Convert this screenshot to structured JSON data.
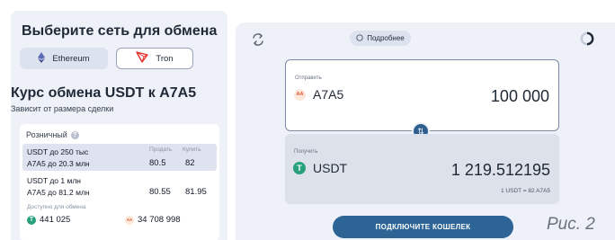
{
  "network": {
    "title": "Выберите сеть для обмена",
    "options": [
      {
        "label": "Ethereum",
        "icon": "ethereum-icon",
        "selected": false
      },
      {
        "label": "Tron",
        "icon": "tron-icon",
        "selected": true
      }
    ]
  },
  "rate": {
    "title": "Курс обмена USDT к A7A5",
    "subtitle": "Зависит от размера сделки",
    "card_title": "Розничный",
    "sell_header": "Продать",
    "buy_header": "Купить",
    "tiers": [
      {
        "line1": "USDT до 250 тыс",
        "line2": "A7A5 до 20.3 млн",
        "sell": "80.5",
        "buy": "82",
        "highlighted": true
      },
      {
        "line1": "USDT до 1 млн",
        "line2": "A7A5 до 81.2 млн",
        "sell": "80.55",
        "buy": "81.95",
        "highlighted": false
      }
    ],
    "available_label": "Доступно для обмена",
    "available_usdt": "441 025",
    "available_a7a5": "34 708 998"
  },
  "exchange": {
    "more_label": "Подробнее",
    "send_label": "Отправить",
    "send_coin": "A7A5",
    "send_coin_icon_text": "AA",
    "send_amount": "100 000",
    "receive_label": "Получить",
    "receive_coin": "USDT",
    "receive_coin_icon_text": "T",
    "receive_amount": "1 219.512195",
    "rate_note": "1 USDT = 82 A7A5",
    "connect_label": "ПОДКЛЮЧИТЕ КОШЕЛЕК"
  },
  "caption": "Рис. 2",
  "colors": {
    "panel_bg": "#eef1f7",
    "accent": "#2d6496",
    "usdt_green": "#26a17b",
    "tron_red": "#e8302a"
  }
}
